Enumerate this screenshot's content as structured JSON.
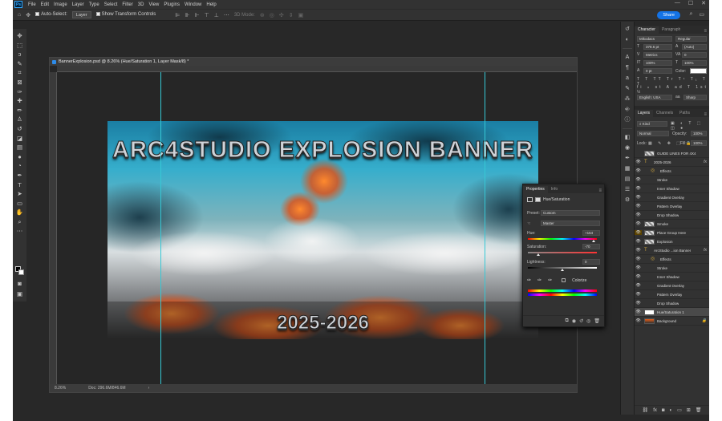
{
  "menubar": {
    "app_icon": "Ps",
    "items": [
      "File",
      "Edit",
      "Image",
      "Layer",
      "Type",
      "Select",
      "Filter",
      "3D",
      "View",
      "Plugins",
      "Window",
      "Help"
    ],
    "window_controls": [
      "—",
      "☐",
      "✕"
    ]
  },
  "options_bar": {
    "auto_select_label": "Auto-Select:",
    "auto_select_target": "Layer",
    "show_transform_controls_label": "Show Transform Controls",
    "mode_3d_label": "3D Mode:",
    "share_label": "Share"
  },
  "tools": [
    "move-icon",
    "artboard-icon",
    "lasso-icon",
    "quick-select-icon",
    "crop-icon",
    "frame-icon",
    "eyedropper-icon",
    "healing-icon",
    "brush-icon",
    "stamp-icon",
    "history-brush-icon",
    "eraser-icon",
    "gradient-icon",
    "blur-icon",
    "dodge-icon",
    "pen-icon",
    "type-icon",
    "path-select-icon",
    "rectangle-icon",
    "hand-icon",
    "zoom-icon",
    "more-icon"
  ],
  "document": {
    "tab_title": "BannerExplosion.psd @ 8.26% (Hue/Saturation 1, Layer Mask/8) *",
    "zoom": "8.26%",
    "doc_info": "Doc: 296.6M/846.6M",
    "banner_title": "ARC4STUDIO EXPLOSION BANNER",
    "banner_year": "2025-2026"
  },
  "character_panel": {
    "tabs": [
      "Character",
      "Paragraph"
    ],
    "font_family": "Mikodacs",
    "font_style": "Regular",
    "font_size": "378.6 pt",
    "leading": "(Auto)",
    "kerning": "Metrics",
    "tracking": "0",
    "vertical_scale": "100%",
    "horizontal_scale": "100%",
    "baseline_shift": "0 pt",
    "color_label": "Color:",
    "language": "English: USA",
    "antialias": "Sharp"
  },
  "layers_panel": {
    "tabs": [
      "Layers",
      "Channels",
      "Paths"
    ],
    "filter_kind": "Kind",
    "blend_mode": "Normal",
    "opacity_label": "Opacity:",
    "opacity": "100%",
    "lock_label": "Lock:",
    "fill_label": "Fill:",
    "fill": "100%",
    "layers": [
      {
        "name": "GUIDE LINES FOR 4X4",
        "kind": "pattern",
        "eye": "",
        "fx": false,
        "indent": 0
      },
      {
        "name": "2025-2026",
        "kind": "text",
        "eye": "👁",
        "fx": true,
        "indent": 0
      },
      {
        "name": "Effects",
        "kind": "effects",
        "eye": "👁",
        "fx": false,
        "indent": 1
      },
      {
        "name": "Stroke",
        "kind": "effect",
        "eye": "👁",
        "fx": false,
        "indent": 2
      },
      {
        "name": "Inner Shadow",
        "kind": "effect",
        "eye": "👁",
        "fx": false,
        "indent": 2
      },
      {
        "name": "Gradient Overlay",
        "kind": "effect",
        "eye": "👁",
        "fx": false,
        "indent": 2
      },
      {
        "name": "Pattern Overlay",
        "kind": "effect",
        "eye": "👁",
        "fx": false,
        "indent": 2
      },
      {
        "name": "Drop Shadow",
        "kind": "effect",
        "eye": "👁",
        "fx": false,
        "indent": 2
      },
      {
        "name": "Smoke",
        "kind": "pattern",
        "eye": "👁",
        "fx": false,
        "indent": 0
      },
      {
        "name": "Place Group Here",
        "kind": "pattern",
        "eye": "👁",
        "fx": false,
        "indent": 0,
        "highlight": true
      },
      {
        "name": "Explosion",
        "kind": "pattern",
        "eye": "👁",
        "fx": false,
        "indent": 0
      },
      {
        "name": "ArcStudio ...ion Banner",
        "kind": "text",
        "eye": "👁",
        "fx": true,
        "indent": 0
      },
      {
        "name": "Effects",
        "kind": "effects",
        "eye": "👁",
        "fx": false,
        "indent": 1
      },
      {
        "name": "Stroke",
        "kind": "effect",
        "eye": "👁",
        "fx": false,
        "indent": 2
      },
      {
        "name": "Inner Shadow",
        "kind": "effect",
        "eye": "👁",
        "fx": false,
        "indent": 2
      },
      {
        "name": "Gradient Overlay",
        "kind": "effect",
        "eye": "👁",
        "fx": false,
        "indent": 2
      },
      {
        "name": "Pattern Overlay",
        "kind": "effect",
        "eye": "👁",
        "fx": false,
        "indent": 2
      },
      {
        "name": "Drop Shadow",
        "kind": "effect",
        "eye": "👁",
        "fx": false,
        "indent": 2
      },
      {
        "name": "Hue/Saturation 1",
        "kind": "adjust",
        "eye": "👁",
        "fx": false,
        "indent": 0,
        "selected": true
      },
      {
        "name": "Background",
        "kind": "fill",
        "eye": "👁",
        "fx": false,
        "indent": 0,
        "locked": true
      }
    ],
    "footer_icons": [
      "link-icon",
      "fx-icon",
      "mask-icon",
      "adjustment-icon",
      "folder-icon",
      "new-layer-icon",
      "trash-icon"
    ]
  },
  "properties_panel": {
    "tabs": [
      "Properties",
      "Info"
    ],
    "title": "Hue/Saturation",
    "preset_label": "Preset:",
    "preset_value": "Custom",
    "channel": "Master",
    "hue_label": "Hue:",
    "hue_value": "+164",
    "hue_level": 0.956,
    "saturation_label": "Saturation:",
    "saturation_value": "-70",
    "saturation_level": 0.15,
    "lightness_label": "Lightness:",
    "lightness_value": "0",
    "lightness_level": 0.5,
    "colorize_label": "Colorize"
  },
  "colors": {
    "accent": "#1473e6",
    "guide": "#36c9d6",
    "panel": "#323232",
    "background": "#282828"
  }
}
